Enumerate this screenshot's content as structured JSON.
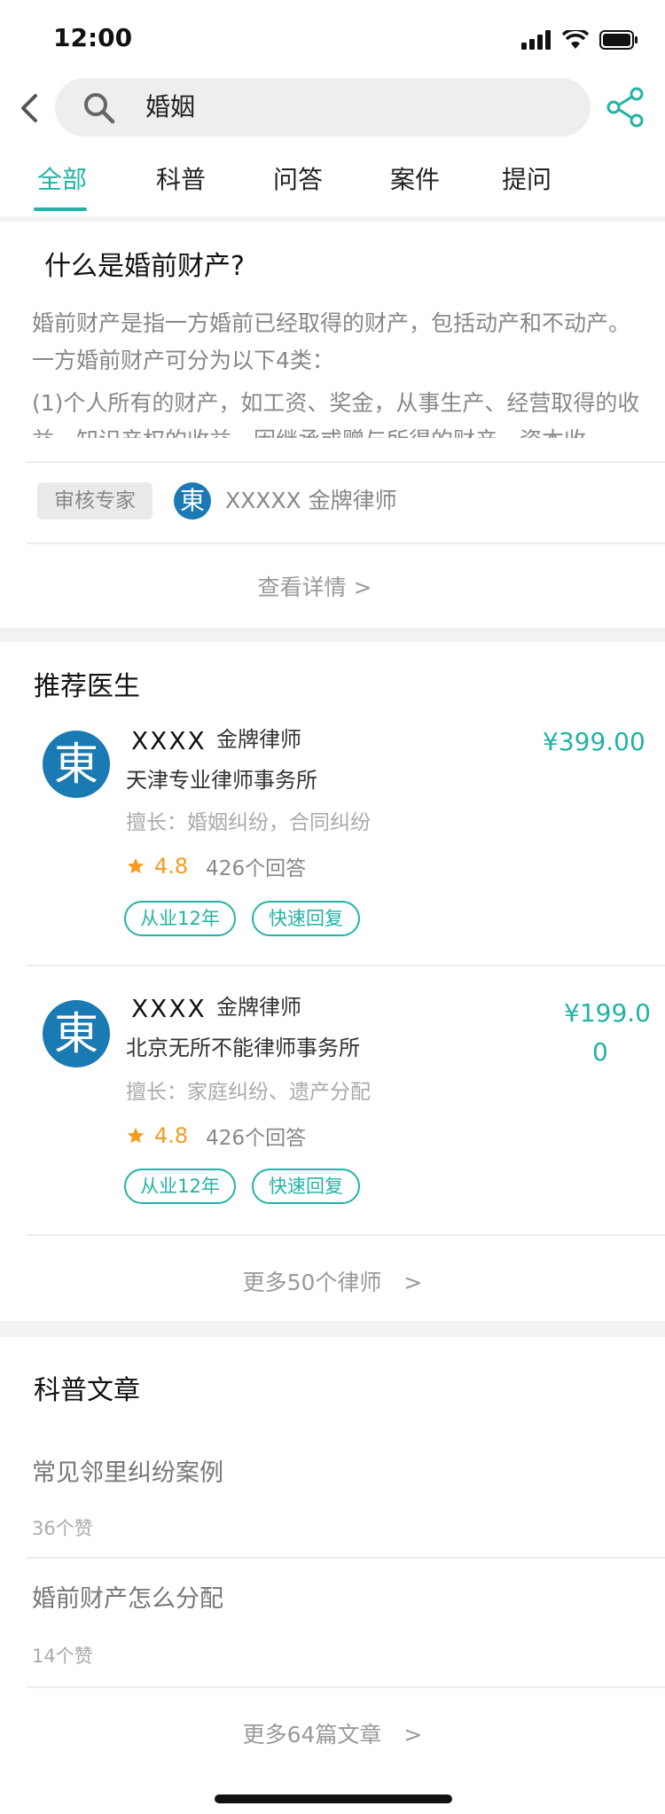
{
  "status_bar": {
    "time": "12:00"
  },
  "search": {
    "query": "婚姻"
  },
  "tabs": [
    "全部",
    "科普",
    "问答",
    "案件",
    "提问"
  ],
  "article": {
    "title": "什么是婚前财产?",
    "body_p1": "婚前财产是指一方婚前已经取得的财产，包括动产和不动产。一方婚前财产可分为以下4类：",
    "body_p2": "(1)个人所有的财产，如工资、奖金，从事生产、经营取得的收益，知识产权的收益，因继承或赠与所得的财产，资本收",
    "reviewer_badge": "审核专家",
    "reviewer_avatar": "東",
    "reviewer_name": "XXXXX 金牌律师",
    "details_link": "查看详情 >"
  },
  "recommended": {
    "title": "推荐医生",
    "lawyers": [
      {
        "avatar": "東",
        "name": "XXXX",
        "title": "金牌律师",
        "firm": "天津专业律师事务所",
        "specialty": "擅长：婚姻纠纷，合同纠纷",
        "rating": "4.8",
        "answers": "426个回答",
        "tag1": "从业12年",
        "tag2": "快速回复",
        "price": "¥399.00"
      },
      {
        "avatar": "東",
        "name": "XXXX",
        "title": "金牌律师",
        "firm": "北京无所不能律师事务所",
        "specialty": "擅长：家庭纠纷、遗产分配",
        "rating": "4.8",
        "answers": "426个回答",
        "tag1": "从业12年",
        "tag2": "快速回复",
        "price_line1": "¥199.0",
        "price_line2": "0"
      }
    ],
    "more_link": "更多50个律师　>"
  },
  "science_articles": {
    "title": "科普文章",
    "items": [
      {
        "title": "常见邻里纠纷案例",
        "likes": "36个赞"
      },
      {
        "title": "婚前财产怎么分配",
        "likes": "14个赞"
      }
    ],
    "more_link": "更多64篇文章　>"
  },
  "colors": {
    "accent": "#22b3a5",
    "rating": "#f59b1e",
    "avatar": "#1a7ab3"
  }
}
